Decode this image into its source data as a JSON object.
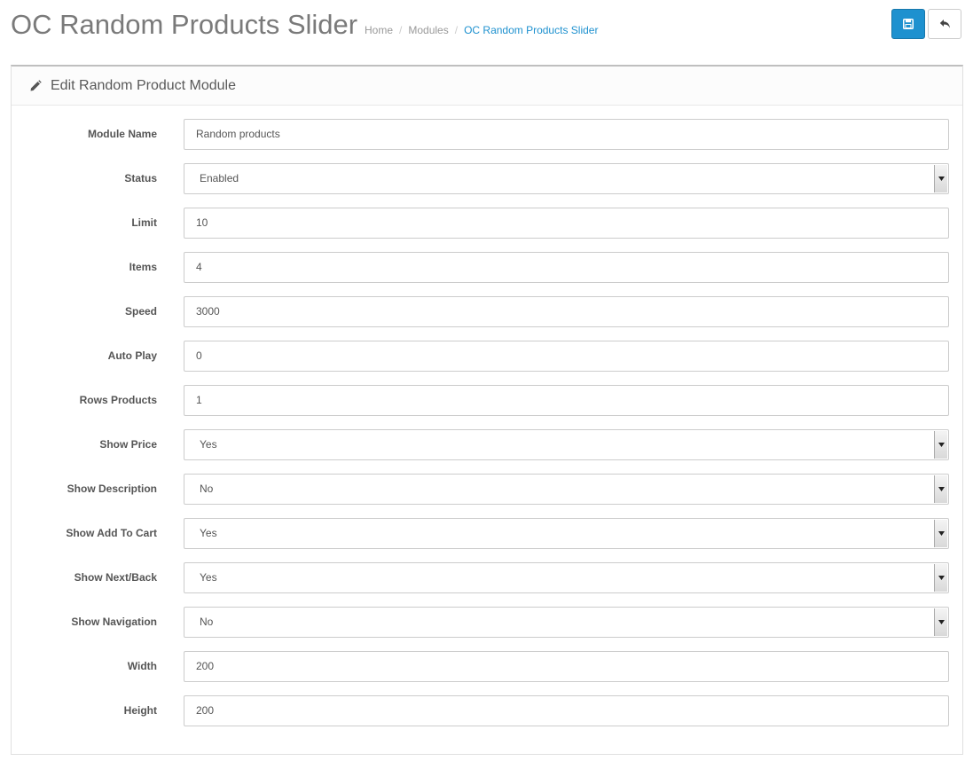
{
  "header": {
    "title": "OC Random Products Slider",
    "breadcrumb": [
      "Home",
      "Modules",
      "OC Random Products Slider"
    ]
  },
  "toolbar": {
    "save_icon": "floppy-disk-icon",
    "back_icon": "reply-arrow-icon",
    "save_color": "#1e91cf"
  },
  "panel": {
    "title": "Edit Random Product Module",
    "icon": "pencil-icon"
  },
  "form": {
    "fields": [
      {
        "label": "Module Name",
        "type": "text",
        "value": "Random products"
      },
      {
        "label": "Status",
        "type": "select",
        "value": "Enabled"
      },
      {
        "label": "Limit",
        "type": "text",
        "value": "10"
      },
      {
        "label": "Items",
        "type": "text",
        "value": "4"
      },
      {
        "label": "Speed",
        "type": "text",
        "value": "3000"
      },
      {
        "label": "Auto Play",
        "type": "text",
        "value": "0"
      },
      {
        "label": "Rows Products",
        "type": "text",
        "value": "1"
      },
      {
        "label": "Show Price",
        "type": "select",
        "value": "Yes"
      },
      {
        "label": "Show Description",
        "type": "select",
        "value": "No"
      },
      {
        "label": "Show Add To Cart",
        "type": "select",
        "value": "Yes"
      },
      {
        "label": "Show Next/Back",
        "type": "select",
        "value": "Yes"
      },
      {
        "label": "Show Navigation",
        "type": "select",
        "value": "No"
      },
      {
        "label": "Width",
        "type": "text",
        "value": "200"
      },
      {
        "label": "Height",
        "type": "text",
        "value": "200"
      }
    ]
  }
}
